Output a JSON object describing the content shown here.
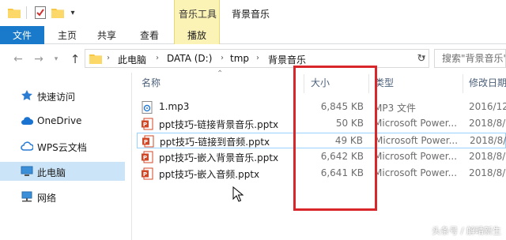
{
  "titlebar": {
    "context_tab_title": "音乐工具",
    "window_title": "背景音乐"
  },
  "ribbon": {
    "tabs": [
      "文件",
      "主页",
      "共享",
      "查看",
      "播放"
    ]
  },
  "address": {
    "crumbs": [
      "此电脑",
      "DATA (D:)",
      "tmp",
      "背景音乐"
    ],
    "search_placeholder": "搜索\"背景音乐\""
  },
  "sidebar": {
    "items": [
      {
        "label": "快速访问",
        "icon": "star-icon"
      },
      {
        "label": "OneDrive",
        "icon": "cloud-icon"
      },
      {
        "label": "WPS云文档",
        "icon": "wps-cloud-icon"
      },
      {
        "label": "此电脑",
        "icon": "computer-icon",
        "selected": true
      },
      {
        "label": "网络",
        "icon": "network-icon"
      }
    ]
  },
  "columns": {
    "name": "名称",
    "size": "大小",
    "type": "类型",
    "date": "修改日期"
  },
  "files": [
    {
      "name": "1.mp3",
      "size": "6,845 KB",
      "type": "MP3 文件",
      "date": "2016/12",
      "icon": "audio-file-icon"
    },
    {
      "name": "ppt技巧-链接背景音乐.pptx",
      "size": "50 KB",
      "type": "Microsoft Power...",
      "date": "2018/8/",
      "icon": "pptx-file-icon"
    },
    {
      "name": "ppt技巧-链接到音频.pptx",
      "size": "49 KB",
      "type": "Microsoft Power...",
      "date": "2018/8/",
      "icon": "pptx-file-icon",
      "focused": true
    },
    {
      "name": "ppt技巧-嵌入背景音乐.pptx",
      "size": "6,642 KB",
      "type": "Microsoft Power...",
      "date": "2018/8/",
      "icon": "pptx-file-icon"
    },
    {
      "name": "ppt技巧-嵌入音频.pptx",
      "size": "6,641 KB",
      "type": "Microsoft Power...",
      "date": "2018/8/",
      "icon": "pptx-file-icon"
    }
  ],
  "watermark": "头条号 / 解晴新生",
  "colors": {
    "accent": "#1979ca",
    "context_tab": "#fbf2b5",
    "selection": "#cce4f7",
    "highlight": "#d9262b"
  }
}
